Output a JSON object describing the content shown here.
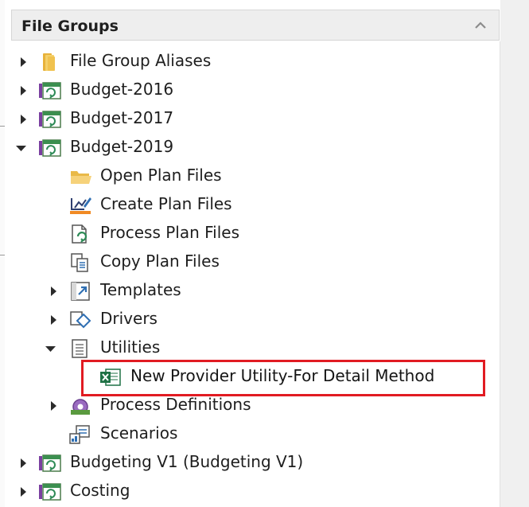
{
  "panel": {
    "title": "File Groups",
    "collapse_icon": "chevron-up-icon"
  },
  "tree": {
    "file_group_aliases": "File Group Aliases",
    "budget_2016": "Budget-2016",
    "budget_2017": "Budget-2017",
    "budget_2019": "Budget-2019",
    "open_plan_files": "Open Plan Files",
    "create_plan_files": "Create Plan Files",
    "process_plan_files": "Process Plan Files",
    "copy_plan_files": "Copy Plan Files",
    "templates": "Templates",
    "drivers": "Drivers",
    "utilities": "Utilities",
    "new_provider_utility": "New Provider Utility-For Detail Method",
    "process_definitions": "Process Definitions",
    "scenarios": "Scenarios",
    "budgeting_v1": "Budgeting V1 (Budgeting V1)",
    "costing": "Costing"
  },
  "colors": {
    "highlight": "#e11b22",
    "header_bg": "#eeeeee",
    "folder": "#f0c24f",
    "group_green": "#2e8b57",
    "group_purple": "#7a3fa0",
    "excel_green": "#1e7145",
    "icon_blue": "#2f6fb3"
  }
}
